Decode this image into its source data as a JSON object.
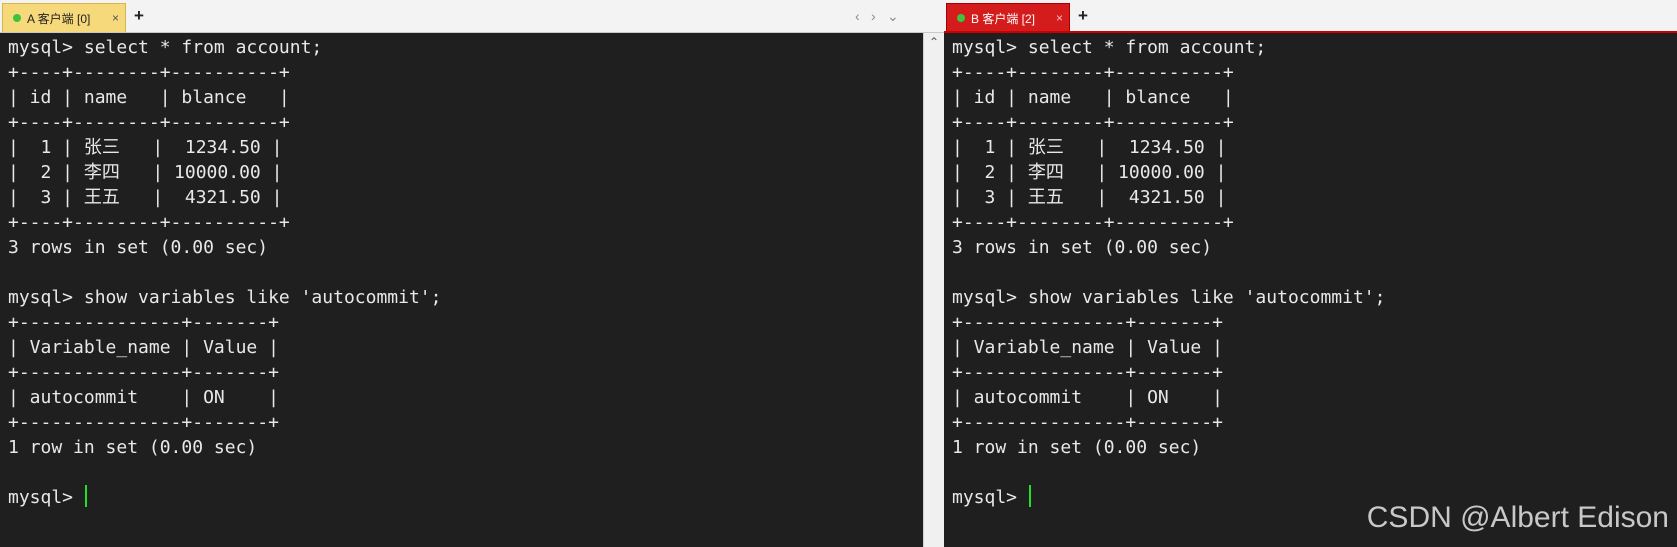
{
  "pane_a": {
    "tab_label": "A 客户端 [0]",
    "close_glyph": "×",
    "add_glyph": "+",
    "nav": {
      "prev": "‹",
      "next": "›",
      "menu": "⌄"
    },
    "scroll_up": "⌃",
    "lines": [
      "mysql> select * from account;",
      "+----+--------+----------+",
      "| id | name   | blance   |",
      "+----+--------+----------+",
      "|  1 | 张三   |  1234.50 |",
      "|  2 | 李四   | 10000.00 |",
      "|  3 | 王五   |  4321.50 |",
      "+----+--------+----------+",
      "3 rows in set (0.00 sec)",
      "",
      "mysql> show variables like 'autocommit';",
      "+---------------+-------+",
      "| Variable_name | Value |",
      "+---------------+-------+",
      "| autocommit    | ON    |",
      "+---------------+-------+",
      "1 row in set (0.00 sec)",
      ""
    ],
    "prompt": "mysql> "
  },
  "pane_b": {
    "tab_label": "B 客户端 [2]",
    "close_glyph": "×",
    "add_glyph": "+",
    "lines": [
      "mysql> select * from account;",
      "+----+--------+----------+",
      "| id | name   | blance   |",
      "+----+--------+----------+",
      "|  1 | 张三   |  1234.50 |",
      "|  2 | 李四   | 10000.00 |",
      "|  3 | 王五   |  4321.50 |",
      "+----+--------+----------+",
      "3 rows in set (0.00 sec)",
      "",
      "mysql> show variables like 'autocommit';",
      "+---------------+-------+",
      "| Variable_name | Value |",
      "+---------------+-------+",
      "| autocommit    | ON    |",
      "+---------------+-------+",
      "1 row in set (0.00 sec)",
      ""
    ],
    "prompt": "mysql> "
  },
  "watermark": "CSDN @Albert Edison",
  "colors": {
    "terminal_bg": "#1f1f1f",
    "terminal_text": "#e8e8e8",
    "cursor": "#20e020",
    "tab_a_bg": "#f6d97a",
    "tab_b_bg": "#d51c1c",
    "active_dot": "#3cc43c"
  }
}
